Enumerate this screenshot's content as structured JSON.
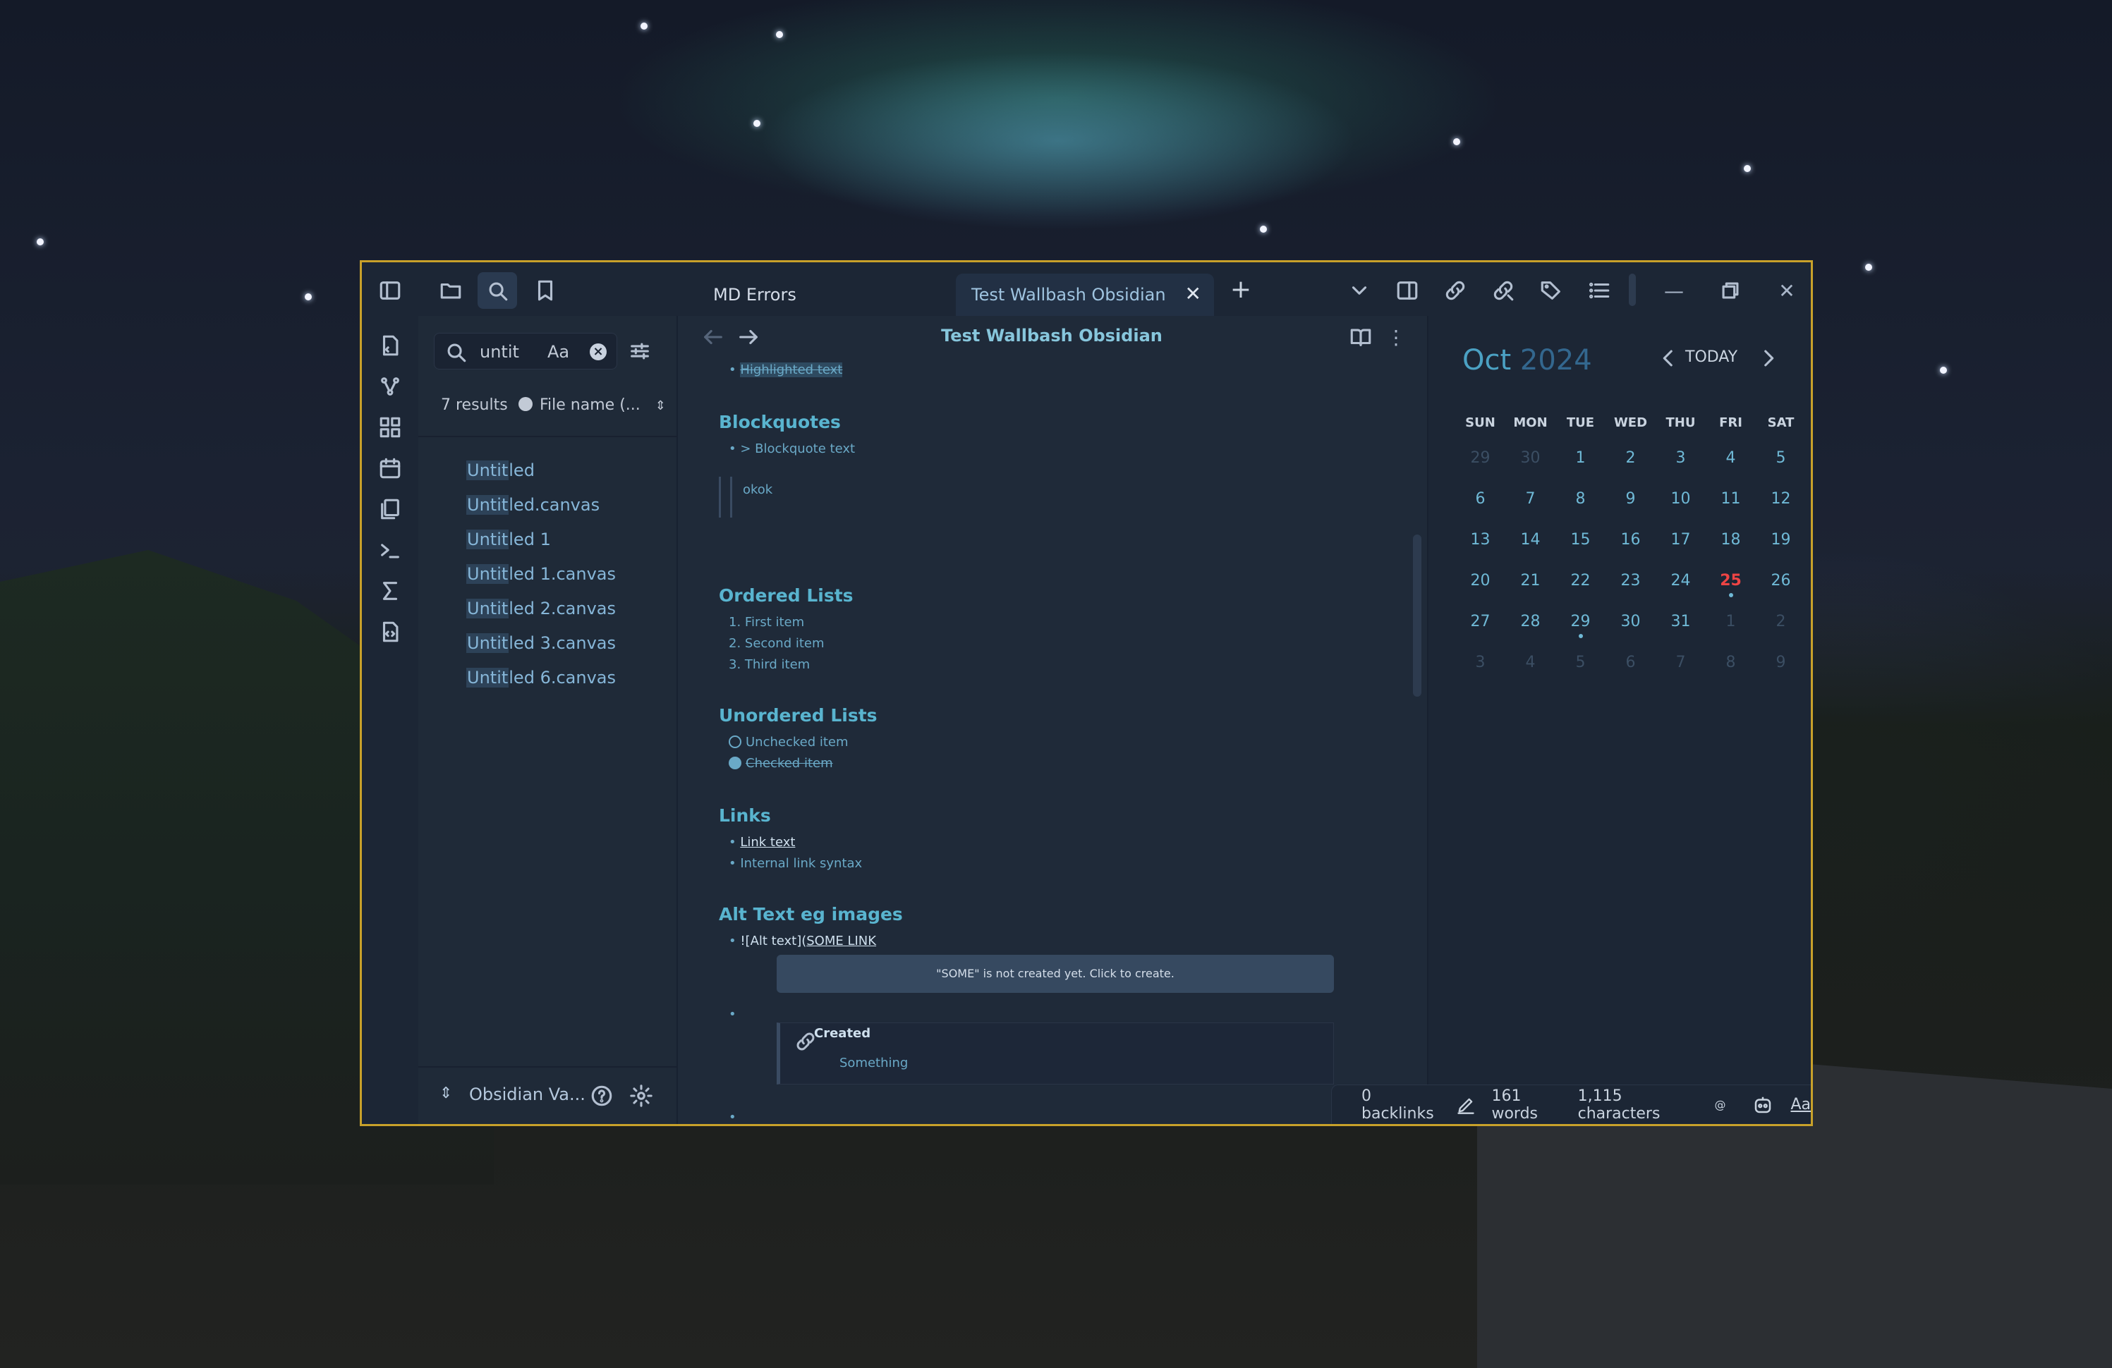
{
  "window": {
    "tabs": [
      {
        "label": "MD Errors"
      },
      {
        "label": "Test Wallbash Obsidian"
      }
    ]
  },
  "search": {
    "query": "untit",
    "case_label": "Aa",
    "results_count": "7 results",
    "sort_label": "File name (...",
    "results": [
      {
        "match": "Untit",
        "rest": "led"
      },
      {
        "match": "Untit",
        "rest": "led.canvas"
      },
      {
        "match": "Untit",
        "rest": "led 1"
      },
      {
        "match": "Untit",
        "rest": "led 1.canvas"
      },
      {
        "match": "Untit",
        "rest": "led 2.canvas"
      },
      {
        "match": "Untit",
        "rest": "led 3.canvas"
      },
      {
        "match": "Untit",
        "rest": "led 6.canvas"
      }
    ]
  },
  "vault": {
    "name": "Obsidian Va..."
  },
  "editor": {
    "title": "Test Wallbash Obsidian",
    "highlighted": "Highlighted text",
    "h_blockquotes": "Blockquotes",
    "blockquote_item": "> Blockquote text",
    "blockquote_body": "okok",
    "h_ordered": "Ordered Lists",
    "ordered": [
      "1. First item",
      "2. Second item",
      "3. Third item"
    ],
    "h_unordered": "Unordered Lists",
    "unchecked": "Unchecked item",
    "checked": "Checked item",
    "h_links": "Links",
    "link_text": "Link text",
    "internal_link": "Internal link syntax",
    "h_alt": "Alt Text eg images",
    "alt_prefix": "![Alt text](",
    "alt_link": "SOME LINK",
    "tooltip": "\"SOME\" is not created yet. Click to create.",
    "callout_title": "Created",
    "callout_body": "Something"
  },
  "calendar": {
    "month": "Oct",
    "year": "2024",
    "today_label": "TODAY",
    "dow": [
      "SUN",
      "MON",
      "TUE",
      "WED",
      "THU",
      "FRI",
      "SAT"
    ],
    "weeks": [
      [
        "29",
        "30",
        "1",
        "2",
        "3",
        "4",
        "5"
      ],
      [
        "6",
        "7",
        "8",
        "9",
        "10",
        "11",
        "12"
      ],
      [
        "13",
        "14",
        "15",
        "16",
        "17",
        "18",
        "19"
      ],
      [
        "20",
        "21",
        "22",
        "23",
        "24",
        "25",
        "26"
      ],
      [
        "27",
        "28",
        "29",
        "30",
        "31",
        "1",
        "2"
      ],
      [
        "3",
        "4",
        "5",
        "6",
        "7",
        "8",
        "9"
      ]
    ],
    "today": "25"
  },
  "status": {
    "backlinks": "0 backlinks",
    "words": "161 words",
    "chars": "1,115 characters",
    "aa": "Aa"
  },
  "colors": {
    "accent": "#59b4cf",
    "frame": "#c8a12a",
    "today": "#e44444"
  }
}
